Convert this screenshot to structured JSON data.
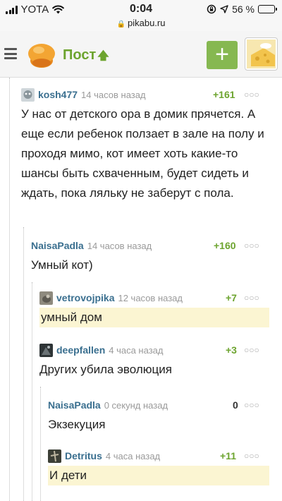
{
  "status_bar": {
    "carrier": "YOTA",
    "time": "0:04",
    "battery": "56 %",
    "battery_level": 0.56,
    "url": "pikabu.ru"
  },
  "header": {
    "title": "Пост",
    "add_label": "+"
  },
  "comments": [
    {
      "user": "kosh477",
      "time": "14 часов назад",
      "rating": "+161",
      "text": "У нас от детского ора в домик прячется. А еще если ребенок ползает в зале на полу и проходя мимо, кот имеет хоть какие-то шансы быть схваченным, будет сидеть и ждать, пока ляльку не заберут с пола."
    },
    {
      "user": "NaisaPadla",
      "time": "14 часов назад",
      "rating": "+160",
      "text": "Умный кот)"
    },
    {
      "user": "vetrovojpika",
      "time": "12 часов назад",
      "rating": "+7",
      "text": "умный дом"
    },
    {
      "user": "deepfallen",
      "time": "4 часа назад",
      "rating": "+3",
      "text": "Других убила эволюция"
    },
    {
      "user": "NaisaPadla",
      "time": "0 секунд назад",
      "rating": "0",
      "text": "Экзекуция"
    },
    {
      "user": "Detritus",
      "time": "4 часа назад",
      "rating": "+11",
      "text": "И дети"
    }
  ],
  "icons": {
    "wifi": "wifi-icon",
    "lock": "lock-icon",
    "menu": "menu-dots-icon"
  },
  "colors": {
    "brand_green": "#6da42f",
    "username_blue": "#3a6f8f",
    "highlight": "#fbf5d2"
  }
}
